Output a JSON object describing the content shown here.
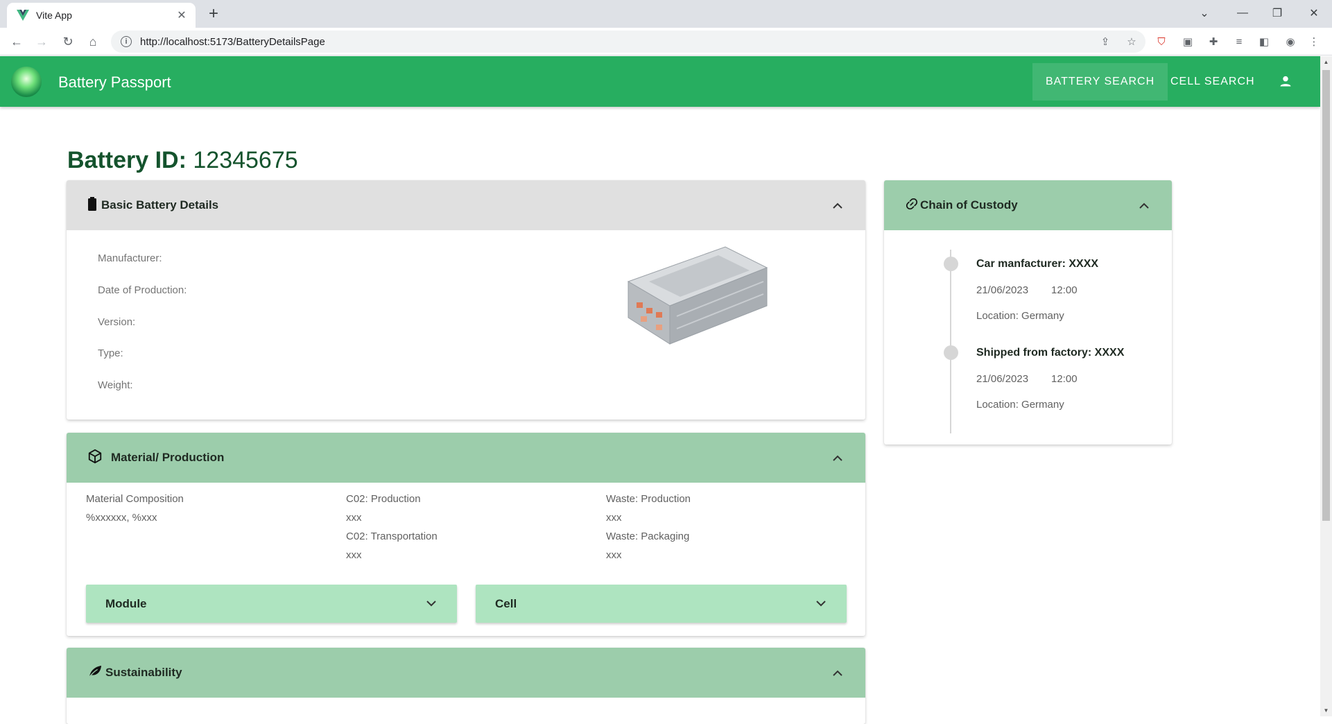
{
  "browser": {
    "tab_title": "Vite App",
    "url": "http://localhost:5173/BatteryDetailsPage"
  },
  "header": {
    "app_title": "Battery Passport",
    "nav": [
      "BATTERY SEARCH",
      "CELL SEARCH"
    ]
  },
  "page": {
    "heading_label": "Battery ID:",
    "battery_id": "12345675"
  },
  "basic_details": {
    "title": "Basic Battery Details",
    "fields": [
      "Manufacturer:",
      "Date of Production:",
      "Version:",
      "Type:",
      "Weight:"
    ]
  },
  "material": {
    "title": "Material/ Production",
    "composition_label": "Material Composition",
    "composition_value": "%xxxxxx, %xxx",
    "co2_production_label": "C02: Production",
    "co2_production_value": "xxx",
    "co2_transport_label": "C02: Transportation",
    "co2_transport_value": "xxx",
    "waste_production_label": "Waste: Production",
    "waste_production_value": "xxx",
    "waste_packaging_label": "Waste: Packaging",
    "waste_packaging_value": "xxx",
    "module_label": "Module",
    "cell_label": "Cell"
  },
  "sustainability": {
    "title": "Sustainability"
  },
  "custody": {
    "title": "Chain of Custody",
    "events": [
      {
        "title": "Car manfacturer: XXXX",
        "date": "21/06/2023",
        "time": "12:00",
        "location": "Location: Germany"
      },
      {
        "title": "Shipped from factory: XXXX",
        "date": "21/06/2023",
        "time": "12:00",
        "location": "Location: Germany"
      }
    ]
  },
  "colors": {
    "appbar": "#27ae60",
    "panel_header_green": "#9ccdab",
    "panel_header_grey": "#e0e0e0",
    "sub_accordion": "#aee4c0",
    "heading": "#14532d"
  }
}
